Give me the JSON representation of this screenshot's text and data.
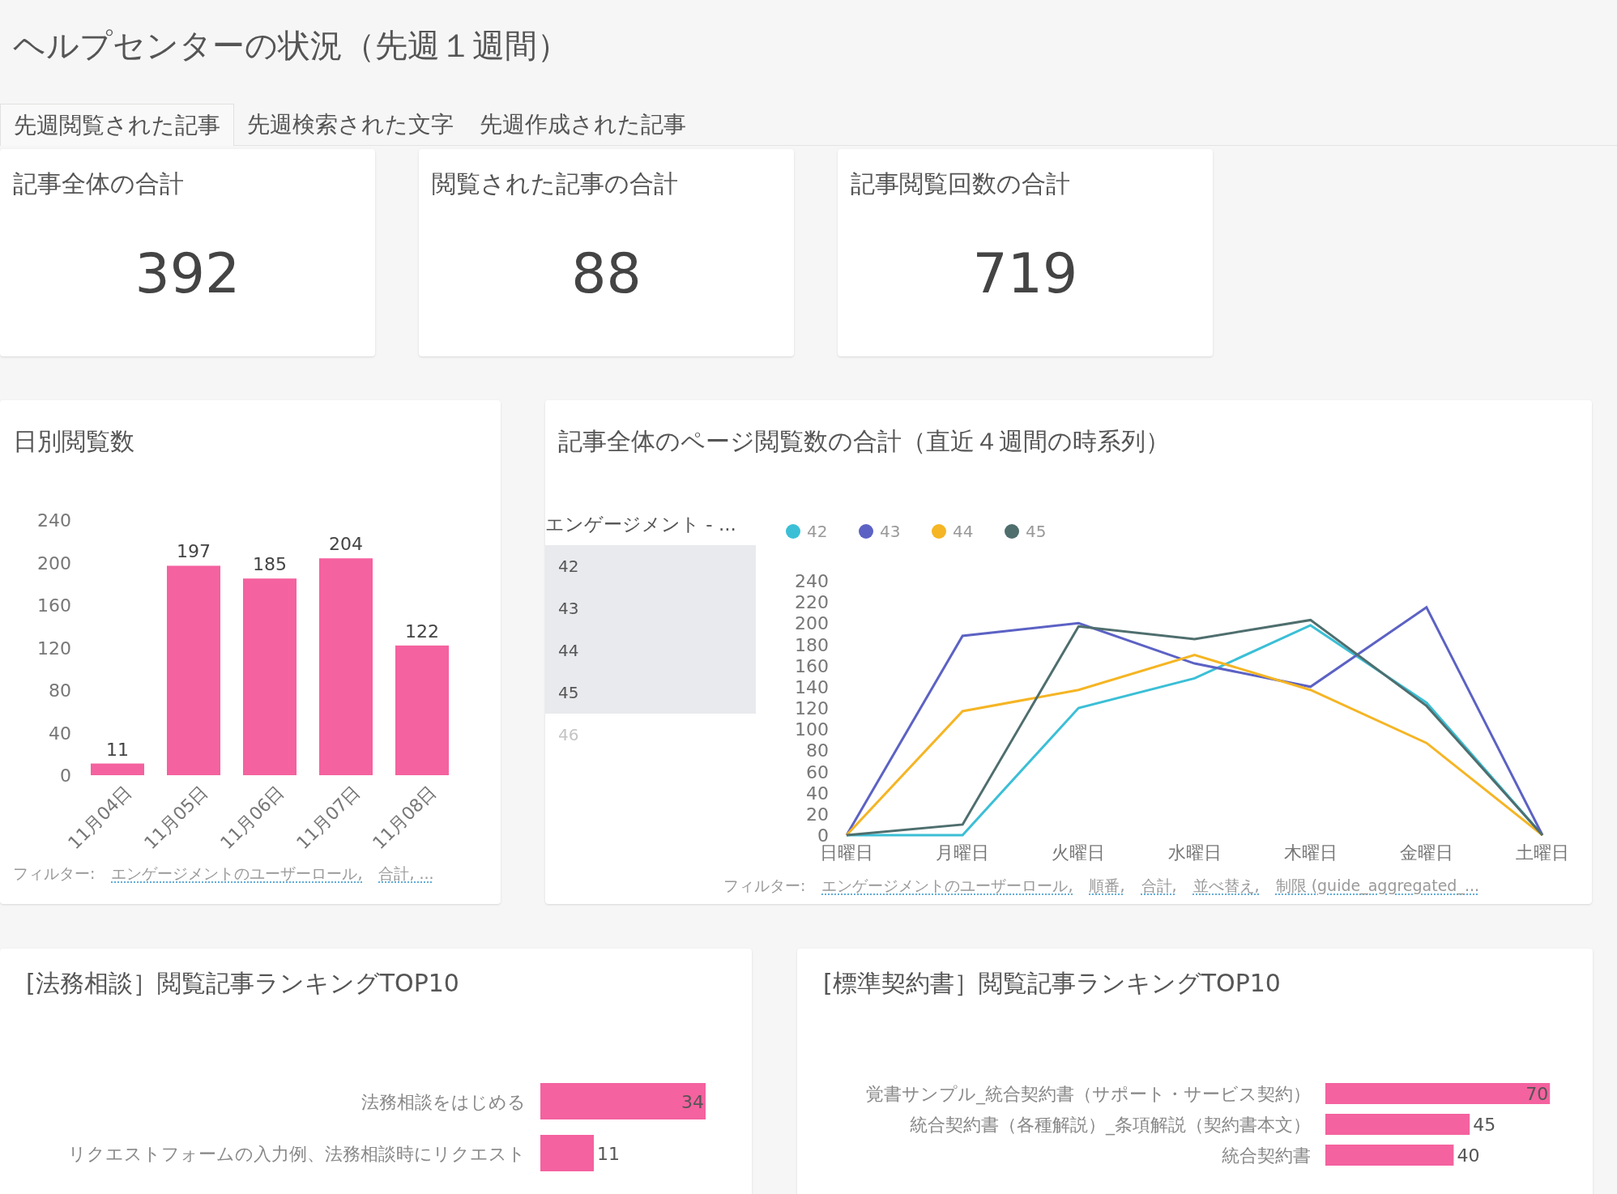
{
  "title": "ヘルプセンターの状況（先週１週間）",
  "tabs": [
    {
      "label": "先週閲覧された記事",
      "selected": true
    },
    {
      "label": "先週検索された文字",
      "selected": false
    },
    {
      "label": "先週作成された記事",
      "selected": false
    }
  ],
  "kpis": [
    {
      "title": "記事全体の合計",
      "value": "392"
    },
    {
      "title": "閲覧された記事の合計",
      "value": "88"
    },
    {
      "title": "記事閲覧回数の合計",
      "value": "719"
    }
  ],
  "daily_chart": {
    "title": "日別閲覧数",
    "chart_data": {
      "type": "bar",
      "categories": [
        "11月04日",
        "11月05日",
        "11月06日",
        "11月07日",
        "11月08日"
      ],
      "values": [
        11,
        197,
        185,
        204,
        122
      ],
      "ylim": [
        0,
        240
      ],
      "yticks": [
        0,
        40,
        80,
        120,
        160,
        200,
        240
      ],
      "data_labels": true
    },
    "filters": {
      "label": "フィルター:",
      "items": [
        "エンゲージメントのユーザーロール,",
        "合計, ..."
      ]
    }
  },
  "weekly_chart": {
    "title": "記事全体のページ閲覧数の合計（直近４週間の時系列）",
    "legend_list": {
      "header": "エンゲージメント - ...",
      "items": [
        {
          "label": "42",
          "selected": true
        },
        {
          "label": "43",
          "selected": true
        },
        {
          "label": "44",
          "selected": true
        },
        {
          "label": "45",
          "selected": true
        },
        {
          "label": "46",
          "selected": false
        }
      ]
    },
    "chart_data": {
      "type": "line",
      "legend": true,
      "categories": [
        "日曜日",
        "月曜日",
        "火曜日",
        "水曜日",
        "木曜日",
        "金曜日",
        "土曜日"
      ],
      "ylim": [
        0,
        240
      ],
      "yticks": [
        0,
        20,
        40,
        60,
        80,
        100,
        120,
        140,
        160,
        180,
        200,
        220,
        240
      ],
      "series": [
        {
          "name": "42",
          "color": "#3bbfd6",
          "values": [
            0,
            0,
            120,
            148,
            198,
            125,
            0
          ]
        },
        {
          "name": "43",
          "color": "#5c62c4",
          "values": [
            0,
            188,
            200,
            162,
            140,
            215,
            0
          ]
        },
        {
          "name": "44",
          "color": "#f5b524",
          "values": [
            0,
            117,
            137,
            170,
            137,
            87,
            0
          ]
        },
        {
          "name": "45",
          "color": "#4f6e6e",
          "values": [
            0,
            10,
            197,
            185,
            203,
            122,
            0
          ]
        }
      ]
    },
    "filters": {
      "label": "フィルター:",
      "items": [
        "エンゲージメントのユーザーロール,",
        "順番,",
        "合計,",
        "並べ替え,",
        "制限 (guide_aggregated_..."
      ]
    }
  },
  "ranking_cards": [
    {
      "title": "[法務相談］閲覧記事ランキングTOP10",
      "chart_data": {
        "type": "bar",
        "orientation": "horizontal",
        "categories": [
          "法務相談をはじめる",
          "リクエストフォームの入力例、法務相談時にリクエスト"
        ],
        "values": [
          34,
          11
        ],
        "data_labels": true
      }
    },
    {
      "title": "[標準契約書］閲覧記事ランキングTOP10",
      "chart_data": {
        "type": "bar",
        "orientation": "horizontal",
        "categories": [
          "覚書サンプル_統合契約書（サポート・サービス契約）",
          "統合契約書（各種解説）_条項解説（契約書本文）",
          "統合契約書"
        ],
        "values": [
          70,
          45,
          40
        ],
        "data_labels": true
      }
    }
  ]
}
